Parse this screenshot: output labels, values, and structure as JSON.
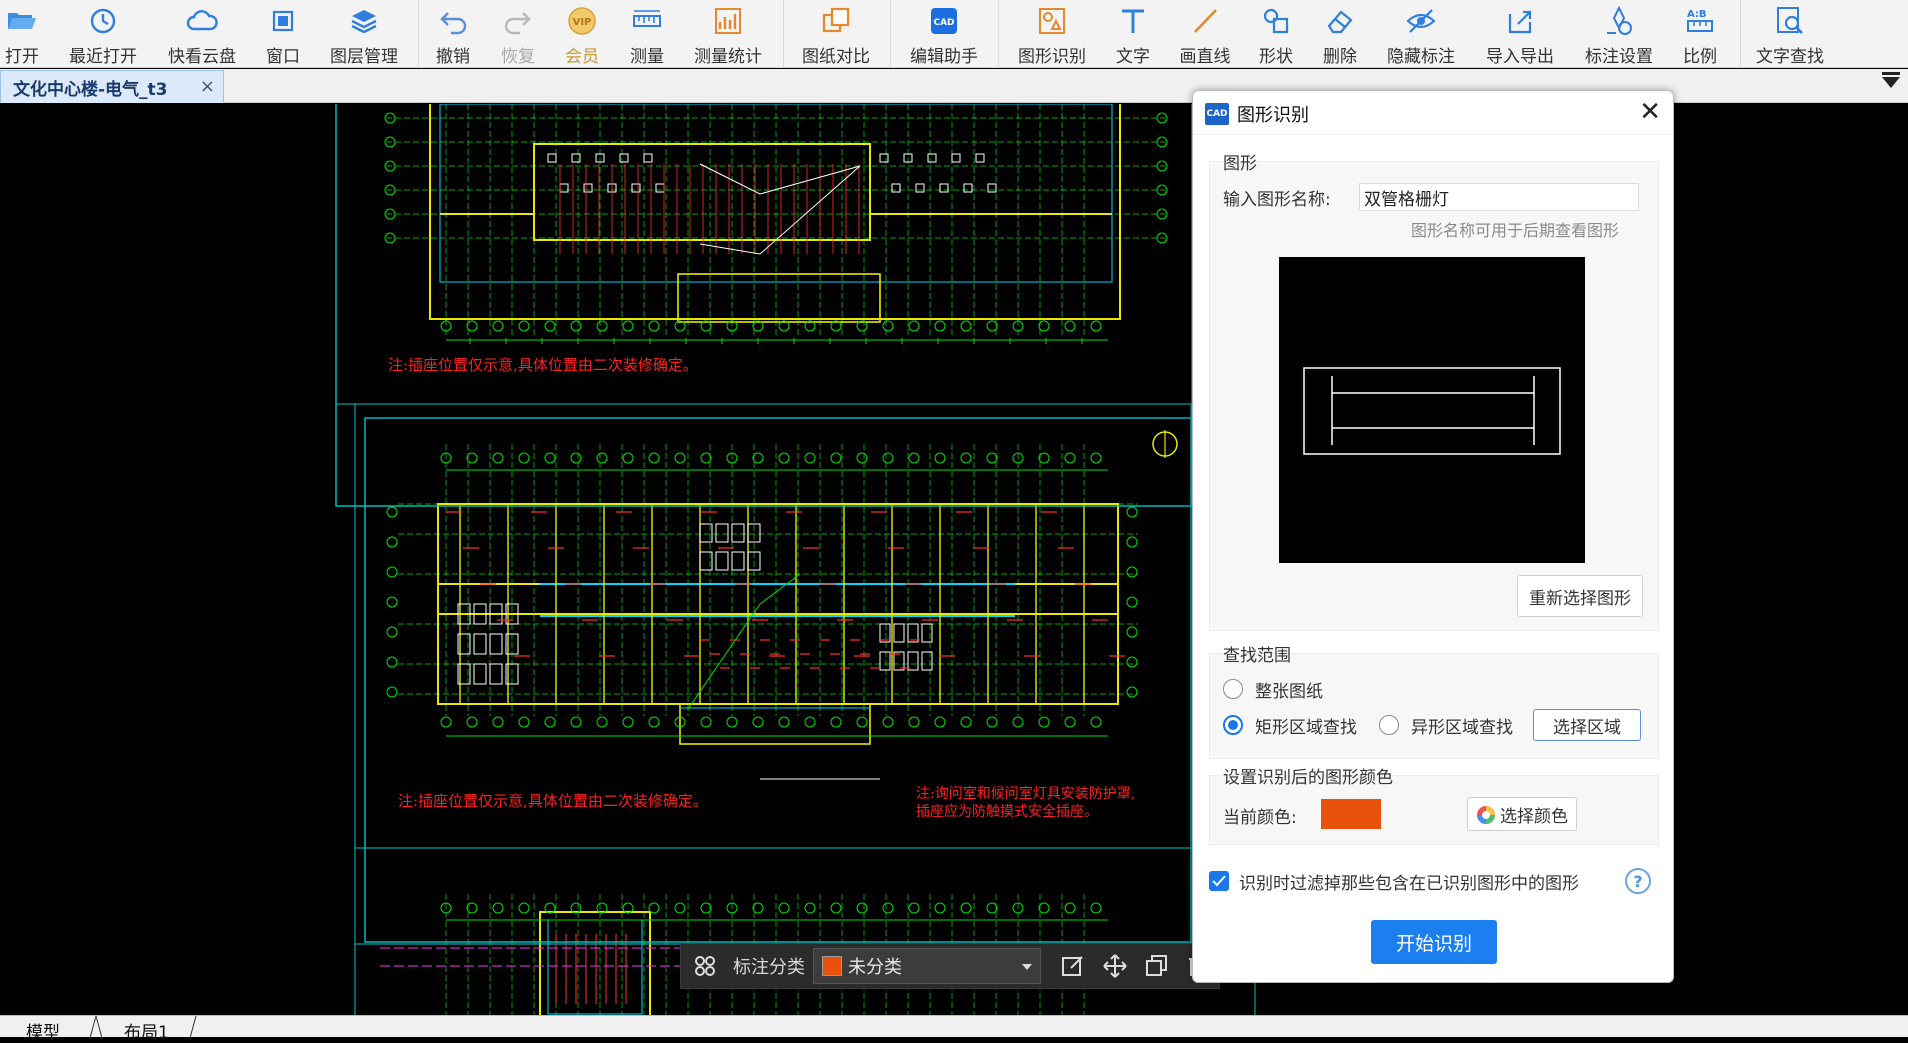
{
  "toolbar": {
    "items": [
      {
        "label": "打开",
        "icon": "folder-open-icon"
      },
      {
        "label": "最近打开",
        "icon": "clock-history-icon"
      },
      {
        "label": "快看云盘",
        "icon": "cloud-icon"
      },
      {
        "label": "窗口",
        "icon": "window-frame-icon"
      },
      {
        "label": "图层管理",
        "icon": "layers-icon"
      },
      {
        "label": "撤销",
        "icon": "undo-icon"
      },
      {
        "label": "恢复",
        "icon": "redo-icon"
      },
      {
        "label": "会员",
        "icon": "vip-badge-icon"
      },
      {
        "label": "测量",
        "icon": "ruler-icon"
      },
      {
        "label": "测量统计",
        "icon": "measure-stats-icon"
      },
      {
        "label": "图纸对比",
        "icon": "compare-icon"
      },
      {
        "label": "编辑助手",
        "icon": "cad-edit-icon"
      },
      {
        "label": "图形识别",
        "icon": "shape-recognize-icon"
      },
      {
        "label": "文字",
        "icon": "text-t-icon"
      },
      {
        "label": "画直线",
        "icon": "line-icon"
      },
      {
        "label": "形状",
        "icon": "shapes-icon"
      },
      {
        "label": "删除",
        "icon": "eraser-icon"
      },
      {
        "label": "隐藏标注",
        "icon": "eye-hidden-icon"
      },
      {
        "label": "导入导出",
        "icon": "import-export-icon"
      },
      {
        "label": "标注设置",
        "icon": "annotation-settings-icon"
      },
      {
        "label": "比例",
        "icon": "scale-ab-icon"
      },
      {
        "label": "文字查找",
        "icon": "text-search-icon"
      }
    ]
  },
  "tabs": {
    "document": "文化中心楼-电气_t3",
    "close": "×"
  },
  "drawing": {
    "note_1": "注:插座位置仅示意,具体位置由二次装修确定。",
    "note_2": "注:插座位置仅示意,具体位置由二次装修确定。",
    "note_3_line1": "注:询问室和候问室灯具安装防护罩,",
    "note_3_line2": "插座应为防触摸式安全插座。",
    "colors": {
      "wall": "#e8e800",
      "grid": "#00e000",
      "frame": "#00c8c8",
      "wiring": "#ff3030",
      "furniture": "#ffffff",
      "note": "#ff2020",
      "cyan": "#00d8ff"
    }
  },
  "annotation_bar": {
    "label": "标注分类",
    "selected": "未分类",
    "selected_color": "#e8520c"
  },
  "statusbar": {
    "model_tab": "模型",
    "layout_tab": "布局1"
  },
  "dialog": {
    "title": "图形识别",
    "logo": "CAD",
    "shape_group_label": "图形",
    "name_label": "输入图形名称:",
    "name_value": "双管格栅灯",
    "name_hint": "图形名称可用于后期查看图形",
    "reselect_button": "重新选择图形",
    "range_group_label": "查找范围",
    "range_options": [
      {
        "label": "整张图纸",
        "checked": false
      },
      {
        "label": "矩形区域查找",
        "checked": true
      },
      {
        "label": "异形区域查找",
        "checked": false
      }
    ],
    "select_area_button": "选择区域",
    "color_group_label": "设置识别后的图形颜色",
    "current_color_label": "当前颜色:",
    "current_color": "#e8520c",
    "choose_color_button": "选择颜色",
    "filter_label": "识别时过滤掉那些包含在已识别图形中的图形",
    "filter_checked": true,
    "help": "?",
    "start_button": "开始识别"
  }
}
